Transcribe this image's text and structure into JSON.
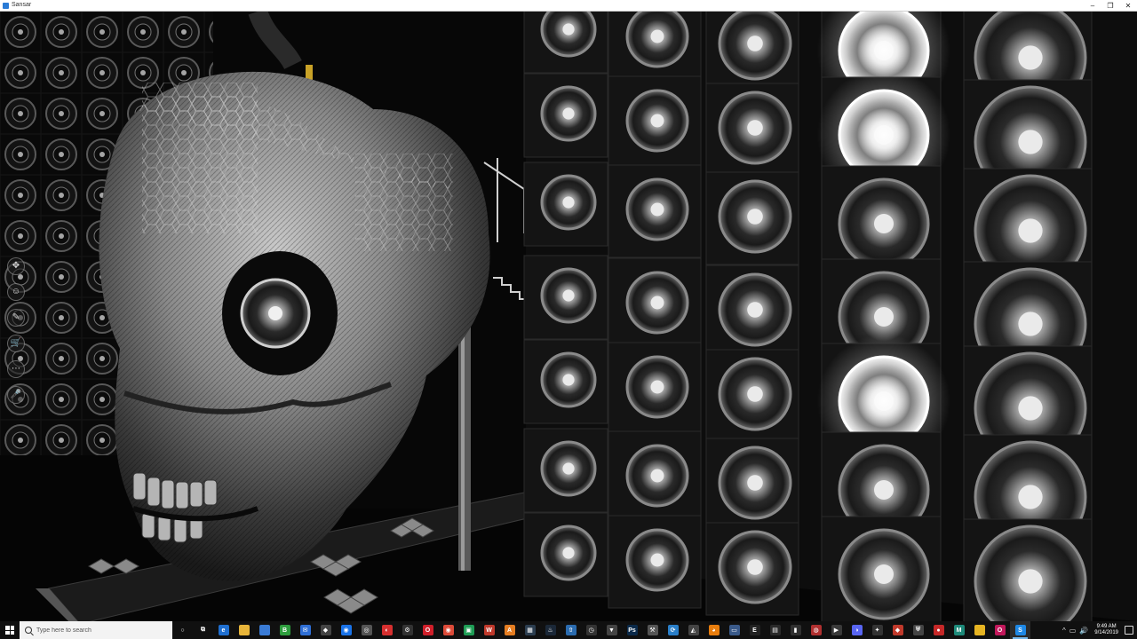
{
  "window": {
    "title": "Sansar",
    "minimize_glyph": "–",
    "maximize_glyph": "❐",
    "close_glyph": "✕"
  },
  "viewport": {
    "scene": "3d-world-view"
  },
  "left_toolbar": [
    {
      "name": "move-camera-tool-icon",
      "glyph": "✥"
    },
    {
      "name": "avatar-menu-icon",
      "glyph": "☺"
    },
    {
      "name": "edit-tool-icon",
      "glyph": "✎"
    },
    {
      "name": "store-cart-icon",
      "glyph": "🛒"
    },
    {
      "name": "more-options-icon",
      "glyph": "⋯"
    },
    {
      "name": "microphone-icon",
      "glyph": "🎤"
    }
  ],
  "taskbar": {
    "search_placeholder": "Type here to search",
    "apps": [
      {
        "name": "cortana-icon",
        "color": "#101010",
        "glyph": "○"
      },
      {
        "name": "task-view-icon",
        "color": "#101010",
        "glyph": "⧉"
      },
      {
        "name": "edge-icon",
        "color": "#1f6fd0",
        "glyph": "e"
      },
      {
        "name": "file-explorer-icon",
        "color": "#e8b53a",
        "glyph": ""
      },
      {
        "name": "store-icon",
        "color": "#3a7bd5",
        "glyph": ""
      },
      {
        "name": "green-app-icon",
        "color": "#2e9e3e",
        "glyph": "B"
      },
      {
        "name": "mail-icon",
        "color": "#2f6fd6",
        "glyph": "✉"
      },
      {
        "name": "unity-icon",
        "color": "#444444",
        "glyph": "◆"
      },
      {
        "name": "chrome-blue-icon",
        "color": "#1a73e8",
        "glyph": "◉"
      },
      {
        "name": "browser-icon",
        "color": "#555555",
        "glyph": "◎"
      },
      {
        "name": "red-browser-icon",
        "color": "#d62f2f",
        "glyph": "◐"
      },
      {
        "name": "settings-icon",
        "color": "#333333",
        "glyph": "⚙"
      },
      {
        "name": "opera-icon",
        "color": "#d01f2a",
        "glyph": "O"
      },
      {
        "name": "chrome-icon",
        "color": "#dd4b39",
        "glyph": "◉"
      },
      {
        "name": "green-tool-icon",
        "color": "#1f9d55",
        "glyph": "▣"
      },
      {
        "name": "red-app-icon",
        "color": "#c0392b",
        "glyph": "W"
      },
      {
        "name": "orange-app-icon",
        "color": "#e67e22",
        "glyph": "A"
      },
      {
        "name": "grid-app-icon",
        "color": "#2c3e50",
        "glyph": "▦"
      },
      {
        "name": "steam-icon",
        "color": "#1b2838",
        "glyph": "♨"
      },
      {
        "name": "upload-icon",
        "color": "#2b6cb0",
        "glyph": "⇧"
      },
      {
        "name": "clock-app-icon",
        "color": "#333333",
        "glyph": "◷"
      },
      {
        "name": "wolf-icon",
        "color": "#444444",
        "glyph": "▼"
      },
      {
        "name": "photoshop-icon",
        "color": "#0b2a4a",
        "glyph": "Ps"
      },
      {
        "name": "tool-icon",
        "color": "#555555",
        "glyph": "⚒"
      },
      {
        "name": "sync-icon",
        "color": "#2a7fc9",
        "glyph": "⟳"
      },
      {
        "name": "vr-icon",
        "color": "#444444",
        "glyph": "◭"
      },
      {
        "name": "blender-icon",
        "color": "#e87d0d",
        "glyph": "◕"
      },
      {
        "name": "display-icon",
        "color": "#3a5a8a",
        "glyph": "▭"
      },
      {
        "name": "epic-icon",
        "color": "#222222",
        "glyph": "E"
      },
      {
        "name": "media-icon",
        "color": "#2a2a2a",
        "glyph": "▤"
      },
      {
        "name": "terminal-icon",
        "color": "#303030",
        "glyph": "▮"
      },
      {
        "name": "capture-icon",
        "color": "#b03030",
        "glyph": "◍"
      },
      {
        "name": "video-icon",
        "color": "#3a3a3a",
        "glyph": "▶"
      },
      {
        "name": "discord-icon",
        "color": "#5865f2",
        "glyph": "◑"
      },
      {
        "name": "chat-icon",
        "color": "#333333",
        "glyph": "✦"
      },
      {
        "name": "red-game-icon",
        "color": "#c0392b",
        "glyph": "◆"
      },
      {
        "name": "shield-icon",
        "color": "#444444",
        "glyph": "⛨"
      },
      {
        "name": "record-icon",
        "color": "#c62828",
        "glyph": "●"
      },
      {
        "name": "maya-icon",
        "color": "#1e8a7a",
        "glyph": "M"
      },
      {
        "name": "folder-icon",
        "color": "#e6b422",
        "glyph": ""
      },
      {
        "name": "opera-gx-icon",
        "color": "#c2185b",
        "glyph": "O"
      },
      {
        "name": "sansar-icon",
        "color": "#1e88e5",
        "glyph": "S"
      }
    ],
    "active_app_index": 41,
    "tray_chevron": "^",
    "tray_network": "▭",
    "tray_volume": "🔊",
    "time": "9:49 AM",
    "date": "9/14/2019"
  }
}
